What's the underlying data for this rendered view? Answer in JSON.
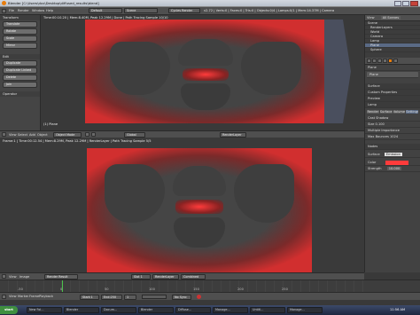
{
  "window": {
    "title": "Blender [C:\\Users\\dus\\Desktop\\diffused_results\\blend]"
  },
  "menubar": {
    "items": [
      "File",
      "Render",
      "Window",
      "Help"
    ],
    "screen": "Default",
    "scene": "Scene",
    "engine": "Cycles Render",
    "stats": "v2.72 | Verts:0 | Faces:0 | Tris:0 | Objects:0/4 | Lamps:0/1 | Mem:14.37M | Camera"
  },
  "toolshelf": {
    "transform_header": "Transform",
    "buttons": [
      "Translate",
      "Rotate",
      "Scale",
      "Mirror"
    ],
    "edit_header": "Edit",
    "edit_buttons": [
      "Duplicate",
      "Duplicate Linked",
      "Delete",
      "Join"
    ],
    "operator_header": "Operator"
  },
  "top_viewport": {
    "info": "Time:00:10.20 | Mem:8.40M, Peak 12.29M | Done | Path Tracing Sample 10/10",
    "label": "(1) Plane",
    "toolbar": [
      "View",
      "Select",
      "Add",
      "Object"
    ],
    "mode": "Object Mode",
    "pivot": "Global",
    "layer": "RenderLayer"
  },
  "bottom_viewport": {
    "info": "Frame:1 | Time:00:12.54 | Mem:8.29M, Peak 12.29M | RenderLayer | Path Tracing Sample 5/5",
    "toolbar": [
      "View",
      "Image"
    ],
    "image_name": "Render Result",
    "slot": "Slot 1",
    "layer": "RenderLayer",
    "pass": "Combined",
    "no_sync": "No Sync"
  },
  "outliner": {
    "header": "View",
    "search": "All Scenes",
    "items": [
      "Scene",
      "RenderLayers",
      "World",
      "Camera",
      "Lamp",
      "Plane",
      "Sphere"
    ]
  },
  "properties": {
    "context_path": "Plane",
    "tabs": [
      "Render",
      "Surface",
      "Volume",
      "Settings"
    ],
    "sections": [
      "Surface",
      "Custom Properties",
      "Preview",
      "Lamp",
      "Nodes"
    ],
    "surface_label": "Surface",
    "surface_value": "Emission",
    "color_label": "Color",
    "strength_label": "Strength",
    "strength_value": "10.000",
    "shader_label": "Cast Shadow",
    "size_label": "Size",
    "size_value": "0.100",
    "multiple_importance": "Multiple Importance",
    "max_bounces_label": "Max Bounces",
    "max_bounces_value": "1024"
  },
  "timeline": {
    "menus": [
      "View",
      "Marker",
      "Frame",
      "Playback"
    ],
    "start_label": "Start:",
    "start": "1",
    "end_label": "End:",
    "end": "250",
    "current": "1",
    "ticks": [
      "-50",
      "0",
      "50",
      "100",
      "150",
      "200",
      "250"
    ],
    "no_sync": "No Sync"
  },
  "taskbar": {
    "start": "start",
    "tasks": [
      "New Fol...",
      "Blender",
      "Docum...",
      "Blender",
      "Diffuse...",
      "Manage...",
      "Untitl...",
      "Manage..."
    ],
    "clock": "11:56 AM"
  },
  "colors": {
    "accent": "#e85a1a",
    "red": "#ff3b3b"
  }
}
